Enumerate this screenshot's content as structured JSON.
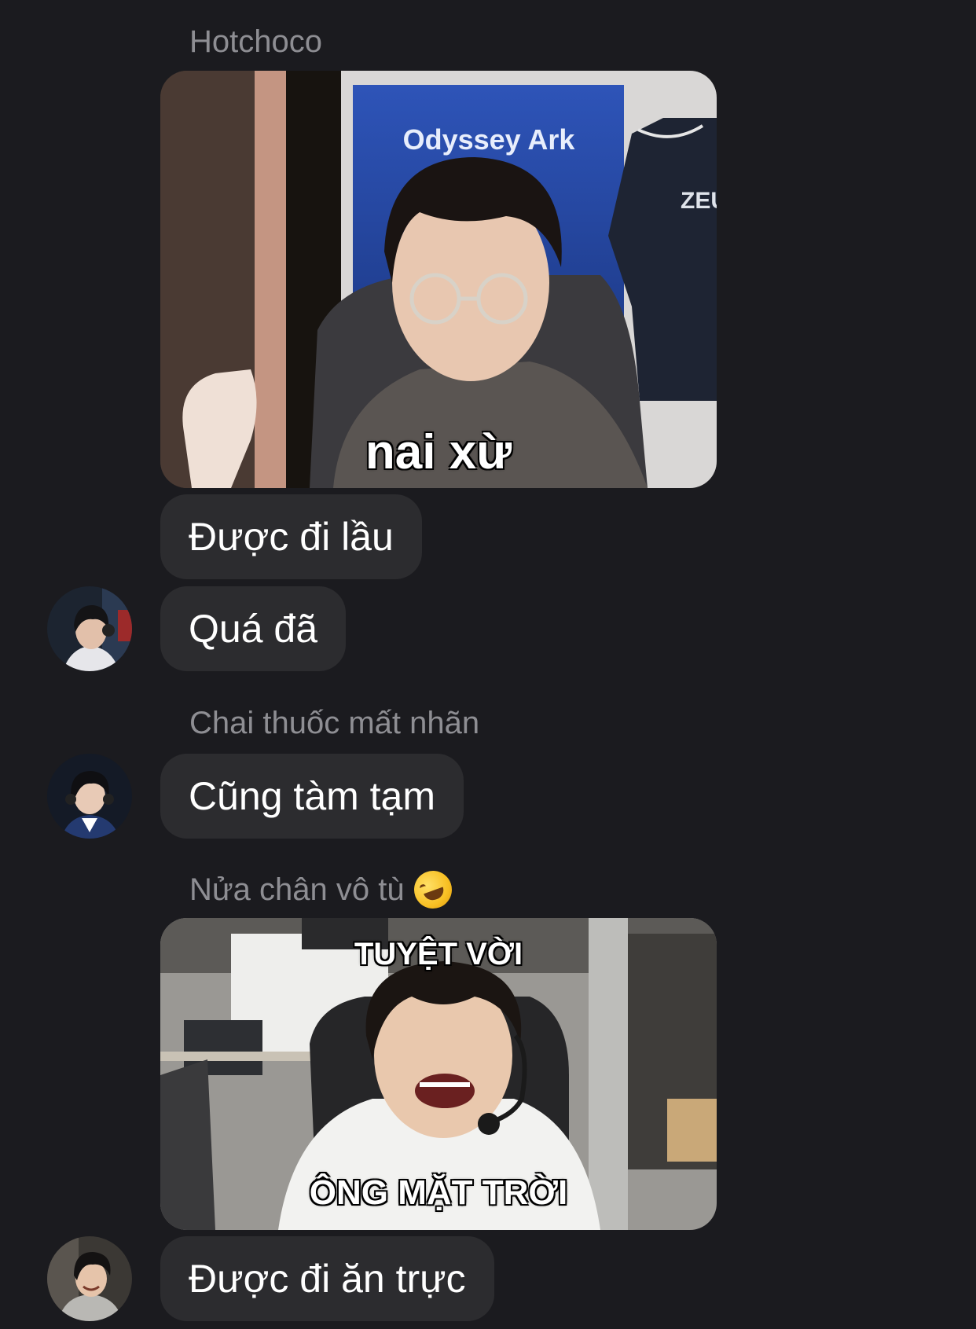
{
  "messages": [
    {
      "type": "sender",
      "name": "Hotchoco"
    },
    {
      "type": "image",
      "caption": "nai xừ",
      "scene_text": {
        "banner": "Odyssey Ark",
        "jersey": "ZEUS"
      }
    },
    {
      "type": "text",
      "text": "Được đi lầu"
    },
    {
      "type": "text",
      "text": "Quá đã"
    },
    {
      "type": "sender",
      "name": "Chai thuốc mất nhãn"
    },
    {
      "type": "text",
      "text": "Cũng tàm tạm"
    },
    {
      "type": "sender",
      "name": "Nửa chân vô tù",
      "emoji": "rolling-on-floor-laughing"
    },
    {
      "type": "image",
      "caption_top": "TUYỆT VỜI",
      "caption_bottom": "ÔNG MẶT TRỜI"
    },
    {
      "type": "text",
      "text": "Được đi ăn trực"
    }
  ],
  "colors": {
    "background": "#1b1b1f",
    "bubble": "#2c2c2f",
    "sender_name": "#8e8e93",
    "message_text": "#ffffff"
  }
}
